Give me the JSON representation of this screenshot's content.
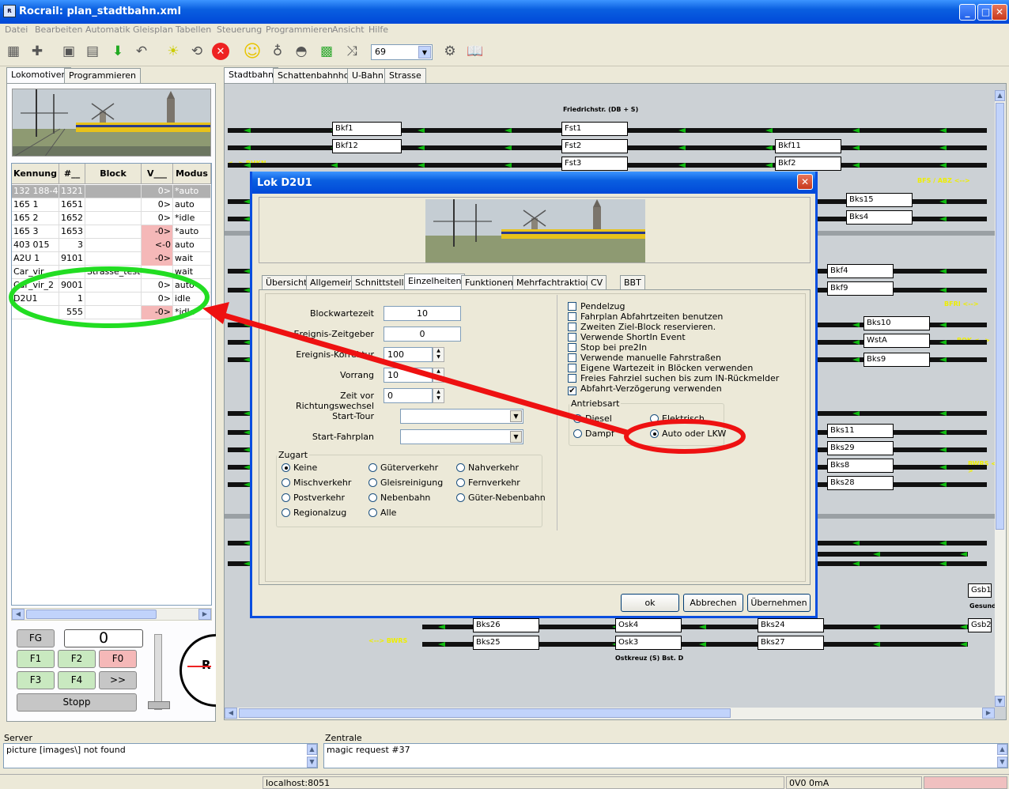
{
  "window": {
    "title": "Rocrail: plan_stadtbahn.xml",
    "minimize": "_",
    "maximize": "□",
    "close": "✕"
  },
  "menu": [
    "Datei",
    "Bearbeiten",
    "Automatik",
    "Gleisplan",
    "Tabellen",
    "Steuerung",
    "Programmieren",
    "Ansicht",
    "Hilfe"
  ],
  "toolbar": {
    "zoom_value": "69"
  },
  "left": {
    "tabs": [
      "Lokomotiven",
      "Programmieren"
    ],
    "columns": [
      "Kennung",
      "#__",
      "Block",
      "V___",
      "Modus"
    ],
    "rows": [
      {
        "id": "132 188-4",
        "addr": "1321",
        "block": "",
        "v": "0>",
        "mode": "*auto",
        "warn": false
      },
      {
        "id": "165 1",
        "addr": "1651",
        "block": "",
        "v": "0>",
        "mode": "auto",
        "warn": false
      },
      {
        "id": "165 2",
        "addr": "1652",
        "block": "",
        "v": "0>",
        "mode": "*idle",
        "warn": false
      },
      {
        "id": "165 3",
        "addr": "1653",
        "block": "",
        "v": "-0>",
        "mode": "*auto",
        "warn": true
      },
      {
        "id": "403 015",
        "addr": "3",
        "block": "",
        "v": "<-0",
        "mode": "auto",
        "warn": true
      },
      {
        "id": "A2U 1",
        "addr": "9101",
        "block": "",
        "v": "-0>",
        "mode": "wait",
        "warn": true
      },
      {
        "id": "Car_vir",
        "addr": "",
        "block": "Strasse_test",
        "v": "",
        "mode": "wait",
        "warn": false
      },
      {
        "id": "Car_vir_2",
        "addr": "9001",
        "block": "",
        "v": "0>",
        "mode": "auto",
        "warn": false
      },
      {
        "id": "D2U1",
        "addr": "1",
        "block": "",
        "v": "0>",
        "mode": "idle",
        "warn": false
      },
      {
        "id": "",
        "addr": "555",
        "block": "",
        "v": "-0>",
        "mode": "*idle",
        "warn": true
      }
    ],
    "controls": {
      "fg": "FG",
      "speed": "0",
      "f1": "F1",
      "f2": "F2",
      "f0": "F0",
      "f3": "F3",
      "f4": "F4",
      "more": ">>",
      "stop": "Stopp",
      "gauge_letter": "R"
    }
  },
  "plan": {
    "tabs": [
      "Stadtbahn",
      "Schattenbahnhof",
      "U-Bahn",
      "Strasse"
    ],
    "labels": {
      "top": "Friedrichstr. (DB + S)",
      "bottom": "Ostkreuz (S) Bst. D",
      "bhkn": "<--> BHKN",
      "bfs": "BFS / ABZ <-->",
      "bfri": "BFRI <-->",
      "bok": "BOK <-->",
      "bwrs_right": "BWRS <-->",
      "bwrs_left": "<--> BWRS",
      "gesund": "Gesund"
    },
    "blocks": [
      "Bkf1",
      "Bkf12",
      "Fst1",
      "Fst2",
      "Fst3",
      "Bkf11",
      "Bkf2",
      "Bks15",
      "Bks4",
      "Bkf4",
      "Bkf9",
      "Bks10",
      "WstA",
      "Bks9",
      "Bks11",
      "Bks29",
      "Bks8",
      "Bks28",
      "Gsb1",
      "Gsb2",
      "Bks26",
      "Bks25",
      "Osk4",
      "Osk3",
      "Bks24",
      "Bks27"
    ]
  },
  "dialog": {
    "title": "Lok D2U1",
    "tabs": [
      "Übersicht",
      "Allgemein",
      "Schnittstelle",
      "Einzelheiten",
      "Funktionen",
      "Mehrfachtraktion",
      "CV",
      "BBT"
    ],
    "fields": [
      {
        "label": "Blockwartezeit",
        "value": "10"
      },
      {
        "label": "Ereignis-Zeitgeber",
        "value": "0"
      },
      {
        "label": "Ereignis-Korrektur",
        "value": "100"
      },
      {
        "label": "Vorrang",
        "value": "10"
      },
      {
        "label": "Zeit vor Richtungswechsel",
        "value": "0"
      }
    ],
    "start_tour_label": "Start-Tour",
    "start_fahrplan_label": "Start-Fahrplan",
    "zugart": {
      "legend": "Zugart",
      "options": [
        "Keine",
        "Güterverkehr",
        "Nahverkehr",
        "Mischverkehr",
        "Gleisreinigung",
        "Fernverkehr",
        "Postverkehr",
        "Nebenbahn",
        "Güter-Nebenbahn",
        "Regionalzug",
        "Alle"
      ],
      "selected": "Keine"
    },
    "checks": [
      {
        "label": "Pendelzug",
        "checked": false
      },
      {
        "label": "Fahrplan Abfahrtzeiten benutzen",
        "checked": false
      },
      {
        "label": "Zweiten Ziel-Block reservieren.",
        "checked": false
      },
      {
        "label": "Verwende ShortIn Event",
        "checked": false
      },
      {
        "label": "Stop bei pre2In",
        "checked": false
      },
      {
        "label": "Verwende manuelle Fahrstraßen",
        "checked": false
      },
      {
        "label": "Eigene Wartezeit in Blöcken verwenden",
        "checked": false
      },
      {
        "label": "Freies Fahrziel suchen bis zum IN-Rückmelder",
        "checked": false
      },
      {
        "label": "Abfahrt-Verzögerung verwenden",
        "checked": true
      }
    ],
    "antrieb": {
      "legend": "Antriebsart",
      "options": [
        "Diesel",
        "Elektrisch",
        "Dampf",
        "Auto oder LKW"
      ],
      "selected": "Auto oder LKW"
    },
    "buttons": {
      "ok": "ok",
      "cancel": "Abbrechen",
      "apply": "Übernehmen"
    }
  },
  "bottom": {
    "server_title": "Server",
    "server_log": "picture [images\\] not found",
    "central_title": "Zentrale",
    "central_log": "magic request #37",
    "status_host": "localhost:8051",
    "status_power": "0V0 0mA"
  },
  "colors": {
    "annotation_green": "#22dd22",
    "annotation_red": "#ee1111",
    "xp_blue": "#0a5fe0"
  }
}
